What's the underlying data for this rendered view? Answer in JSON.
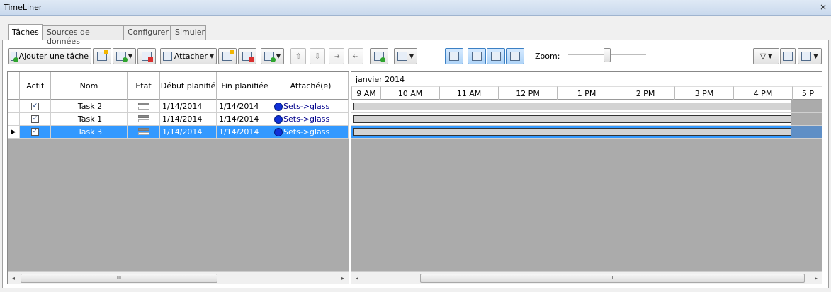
{
  "window": {
    "title": "TimeLiner",
    "close": "×"
  },
  "tabs": [
    "Tâches",
    "Sources de données",
    "Configurer",
    "Simuler"
  ],
  "toolbar": {
    "add_task": "Ajouter une tâche",
    "attach": "Attacher",
    "zoom_label": "Zoom:",
    "zoom_level": 0.5
  },
  "grid": {
    "columns": [
      "Actif",
      "Nom",
      "Etat",
      "Début planifié",
      "Fin planifiée",
      "Attaché(e)"
    ],
    "rows": [
      {
        "active": "✓",
        "name": "Task 2",
        "start": "1/14/2014",
        "end": "1/14/2014",
        "attached": "Sets->glass"
      },
      {
        "active": "✓",
        "name": "Task 1",
        "start": "1/14/2014",
        "end": "1/14/2014",
        "attached": "Sets->glass"
      },
      {
        "active": "✓",
        "name": "Task 3",
        "start": "1/14/2014",
        "end": "1/14/2014",
        "attached": "Sets->glass"
      }
    ],
    "current_row_marker": "▶",
    "scroll": {
      "left": "◂",
      "right": "▸",
      "grip": "III"
    }
  },
  "gantt": {
    "month": "janvier 2014",
    "hours": [
      "9 AM",
      "10 AM",
      "11 AM",
      "12 PM",
      "1 PM",
      "2 PM",
      "3 PM",
      "4 PM",
      "5 P"
    ],
    "scroll": {
      "left": "◂",
      "right": "▸",
      "grip": "III"
    }
  },
  "colors": {
    "selection": "#3399ff",
    "accent": "#3b80c4"
  }
}
